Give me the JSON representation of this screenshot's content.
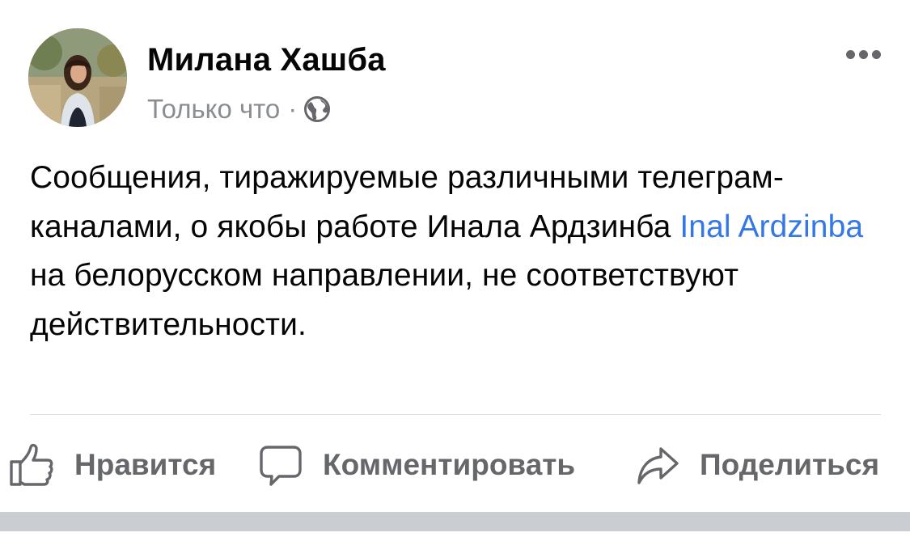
{
  "post": {
    "author": {
      "name": "Милана Хашба",
      "avatar_icon": "profile-photo"
    },
    "timestamp": "Только что",
    "separator": "·",
    "privacy_icon": "globe-icon",
    "more_icon": "more-dots-icon",
    "text": {
      "part1": "Сообщения, тиражируемые различными телеграм-каналами, о якобы работе Инала Ардзинба ",
      "mention": "Inal  Ardzinba",
      "part2": " на белорусском направлении, не соответствуют действительности."
    }
  },
  "actions": {
    "like": {
      "label": "Нравится",
      "icon": "thumbs-up-icon"
    },
    "comment": {
      "label": "Комментировать",
      "icon": "speech-bubble-icon"
    },
    "share": {
      "label": "Поделиться",
      "icon": "share-arrow-icon"
    }
  },
  "colors": {
    "link": "#3578e5",
    "secondary_text": "#8a8d91",
    "action_text": "#65676b",
    "divider": "#dadde1",
    "bottom_bar": "#cacdd2"
  }
}
